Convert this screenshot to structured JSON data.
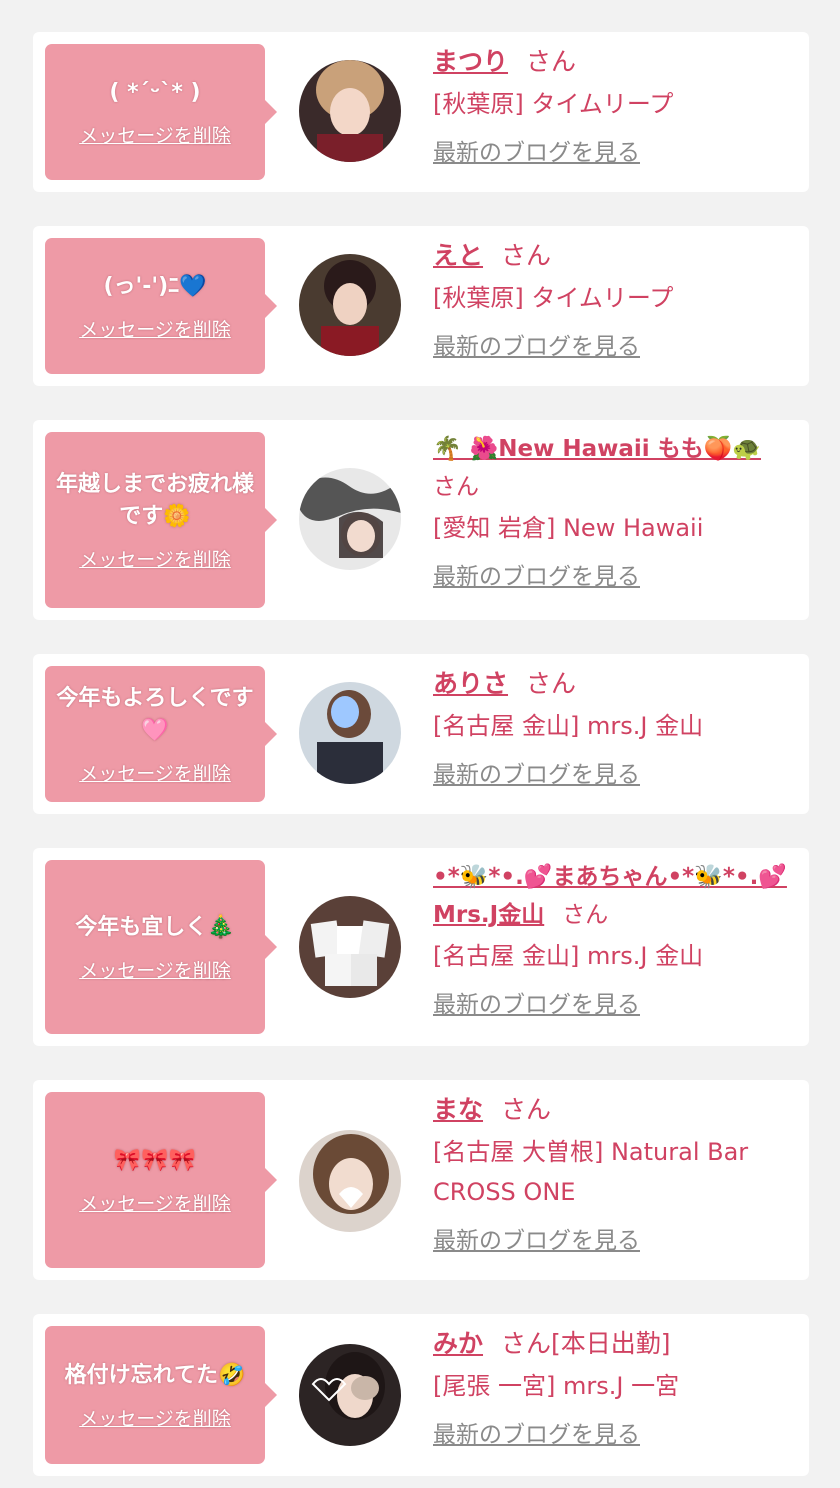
{
  "colors": {
    "background": "#f2f2f2",
    "card": "#ffffff",
    "bubble": "#ee9aa6",
    "accent": "#d04262",
    "muted": "#8a8a8a"
  },
  "common": {
    "delete_label": "メッセージを削除",
    "blog_label": "最新のブログを見る",
    "honorific": "さん"
  },
  "cards": [
    {
      "message": "( *´ᵕ`* )",
      "name": "まつり",
      "suffix": "",
      "shop": "[秋葉原] タイムリープ",
      "avatar_icon": "profile-photo"
    },
    {
      "message": "(っ'-')ﾆ💙",
      "name": "えと",
      "suffix": "",
      "shop": "[秋葉原] タイムリープ",
      "avatar_icon": "profile-photo"
    },
    {
      "message": "年越しまでお疲れ様です🌼",
      "name": "🌴 🌺New Hawaii もも🍑🐢",
      "suffix": "",
      "shop": "[愛知 岩倉] New Hawaii",
      "avatar_icon": "profile-photo"
    },
    {
      "message": "今年もよろしくです🩷",
      "name": "ありさ",
      "suffix": "",
      "shop": "[名古屋 金山] mrs.J 金山",
      "avatar_icon": "profile-photo"
    },
    {
      "message": "今年も宜しく🎄",
      "name": "•*🐝*•.💕まあちゃん•*🐝*•.💕Mrs.J金山",
      "suffix": "",
      "shop": "[名古屋 金山] mrs.J 金山",
      "avatar_icon": "profile-photo"
    },
    {
      "message": "🎀🎀🎀",
      "name": "まな",
      "suffix": "",
      "shop": "[名古屋 大曽根] Natural Bar CROSS ONE",
      "avatar_icon": "profile-photo"
    },
    {
      "message": "格付け忘れてた🤣",
      "name": "みか",
      "suffix": "[本日出勤]",
      "shop": "[尾張 一宮] mrs.J 一宮",
      "avatar_icon": "profile-photo"
    }
  ]
}
